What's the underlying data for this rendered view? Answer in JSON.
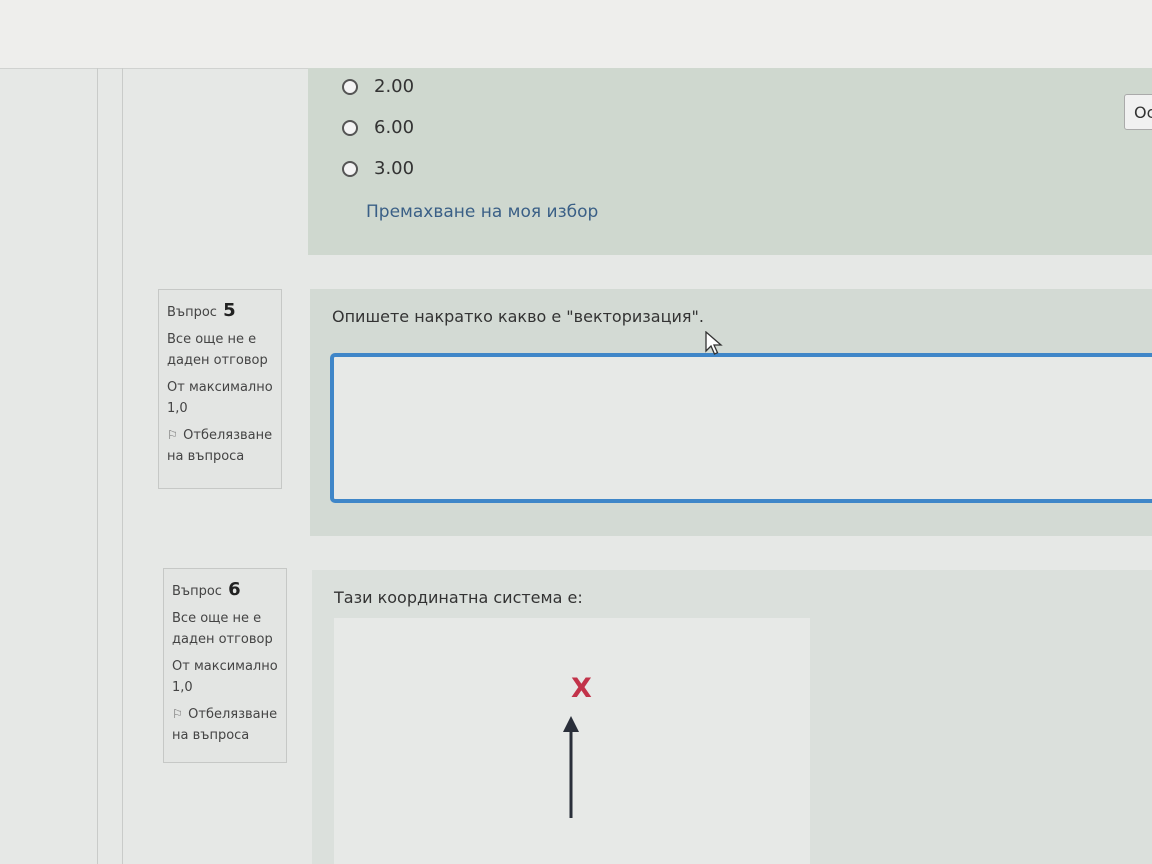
{
  "prev_question": {
    "options": [
      "2.00",
      "6.00",
      "3.00"
    ],
    "clear_choice": "Премахване на моя избор",
    "side_button": "Ос"
  },
  "question5": {
    "label": "Въпрос",
    "number": "5",
    "status": "Все още не е даден отговор",
    "max_points": "От максимално 1,0",
    "flag": "Отбелязване на въпроса",
    "text": "Опишете накратко какво е \"векторизация\".",
    "answer_value": ""
  },
  "question6": {
    "label": "Въпрос",
    "number": "6",
    "status": "Все още не е даден отговор",
    "max_points": "От максимално 1,0",
    "flag": "Отбелязване на въпроса",
    "text": "Тази координатна система е:",
    "axis_label": "X"
  },
  "colors": {
    "accent": "#3f86c8",
    "axis_label": "#c2334a",
    "link": "#3a5f86"
  }
}
